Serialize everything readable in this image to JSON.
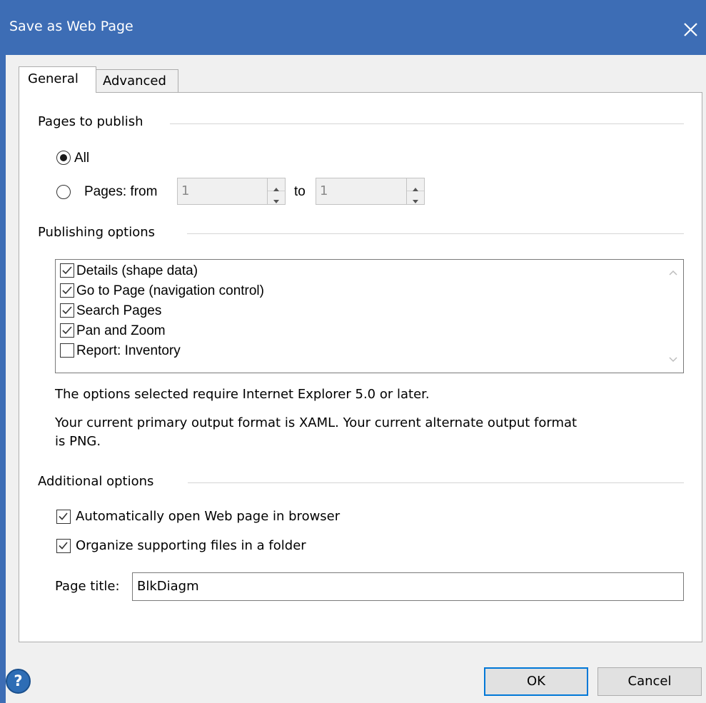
{
  "window": {
    "title": "Save as Web Page"
  },
  "tabs": [
    {
      "label": "General"
    },
    {
      "label": "Advanced"
    }
  ],
  "pages": {
    "group_label": "Pages to publish",
    "all_label": "All",
    "pages_from_label": "Pages: from",
    "from_value": "1",
    "to_label": "to",
    "to_value": "1",
    "selected": "All"
  },
  "publishing": {
    "group_label": "Publishing options",
    "items": [
      {
        "label": "Details (shape data)",
        "checked": true
      },
      {
        "label": "Go to Page (navigation control)",
        "checked": true
      },
      {
        "label": "Search Pages",
        "checked": true
      },
      {
        "label": "Pan and Zoom",
        "checked": true
      },
      {
        "label": "Report: Inventory",
        "checked": false
      }
    ],
    "info_ie": "The options selected require Internet Explorer 5.0 or later.",
    "info_format_line1": "Your current primary output format is XAML. Your current alternate output format",
    "info_format_line2": "is PNG."
  },
  "additional": {
    "group_label": "Additional options",
    "auto_open_label": "Automatically open Web page in browser",
    "auto_open_checked": true,
    "organize_label": "Organize supporting files in a folder",
    "organize_checked": true,
    "page_title_label": "Page title:",
    "page_title_value": "BlkDiagm"
  },
  "buttons": {
    "ok": "OK",
    "cancel": "Cancel",
    "help": "?"
  },
  "colors": {
    "titlebar": "#3d6db5",
    "accent": "#0078d7"
  }
}
